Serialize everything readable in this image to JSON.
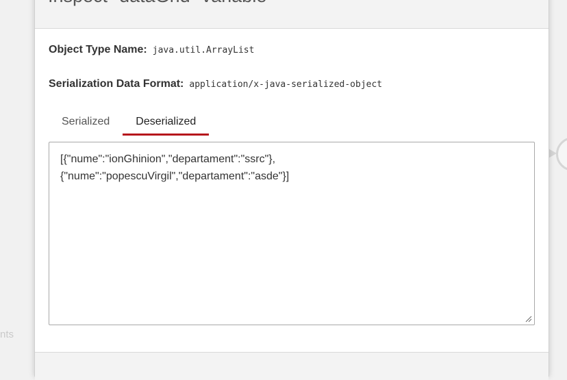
{
  "background": {
    "side_text": "nts"
  },
  "modal": {
    "title": "Inspect \"dataGrid\" variable",
    "object_type_label": "Object Type Name:",
    "object_type_value": "java.util.ArrayList",
    "format_label": "Serialization Data Format:",
    "format_value": "application/x-java-serialized-object",
    "tabs": [
      {
        "label": "Serialized",
        "active": false
      },
      {
        "label": "Deserialized",
        "active": true
      }
    ],
    "content": "[{\"nume\":\"ionGhinion\",\"departament\":\"ssrc\"},\n{\"nume\":\"popescuVirgil\",\"departament\":\"asde\"}]"
  },
  "colors": {
    "accent": "#b5121b"
  }
}
